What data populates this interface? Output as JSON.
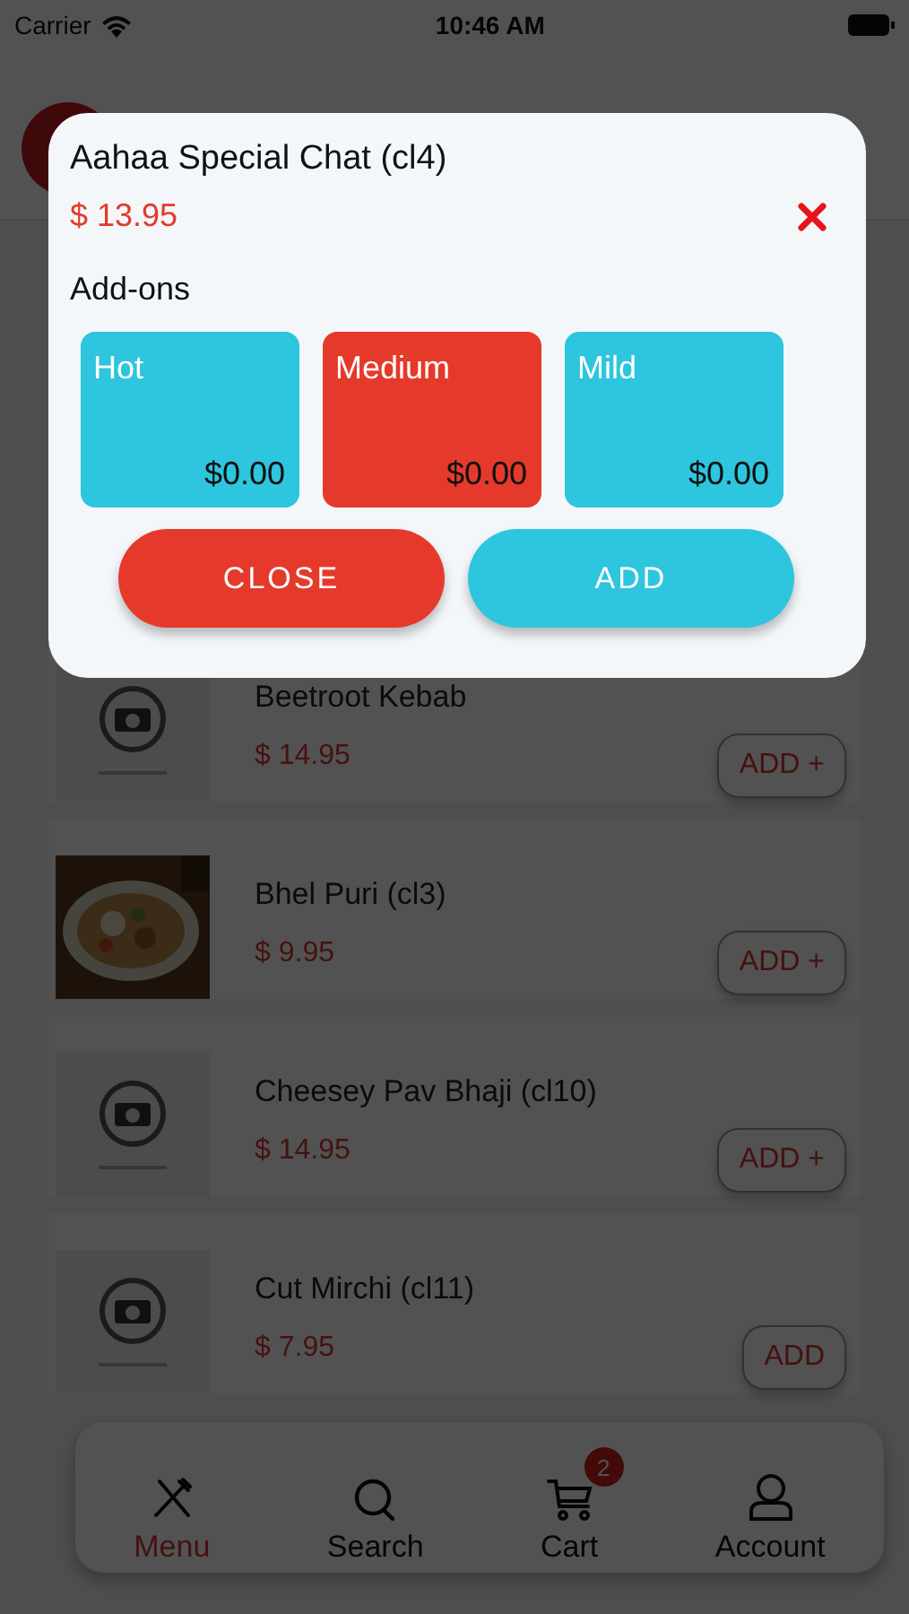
{
  "status_bar": {
    "carrier": "Carrier",
    "time": "10:46 AM"
  },
  "dialog": {
    "title": "Aahaa Special Chat (cl4)",
    "price": "$ 13.95",
    "addons_label": "Add-ons",
    "addons": [
      {
        "name": "Hot",
        "price": "$0.00",
        "selected": false
      },
      {
        "name": "Medium",
        "price": "$0.00",
        "selected": true
      },
      {
        "name": "Mild",
        "price": "$0.00",
        "selected": false
      }
    ],
    "buttons": [
      {
        "label": "CLOSE",
        "kind": "secondary"
      },
      {
        "label": "ADD",
        "kind": "primary"
      }
    ]
  },
  "items": [
    {
      "name": "Beetroot Kebab",
      "price": "$ 14.95",
      "button": "ADD +",
      "kind": "placeholder"
    },
    {
      "name": "Bhel Puri (cl3)",
      "price": "$ 9.95",
      "button": "ADD +"
    },
    {
      "name": "Cheesey Pav Bhaji (cl10)",
      "price": "$ 14.95",
      "button": "ADD +",
      "kind": "placeholder"
    },
    {
      "name": "Cut Mirchi (cl11)",
      "price": "$ 7.95",
      "button": "ADD",
      "kind": "placeholder"
    }
  ],
  "nav": [
    {
      "label": "Menu",
      "kind": "menu",
      "selected": true
    },
    {
      "label": "Search",
      "kind": "search",
      "selected": false
    },
    {
      "label": "Cart",
      "kind": "cart",
      "selected": false,
      "badge": "2"
    },
    {
      "label": "Account",
      "kind": "account",
      "selected": false
    }
  ]
}
